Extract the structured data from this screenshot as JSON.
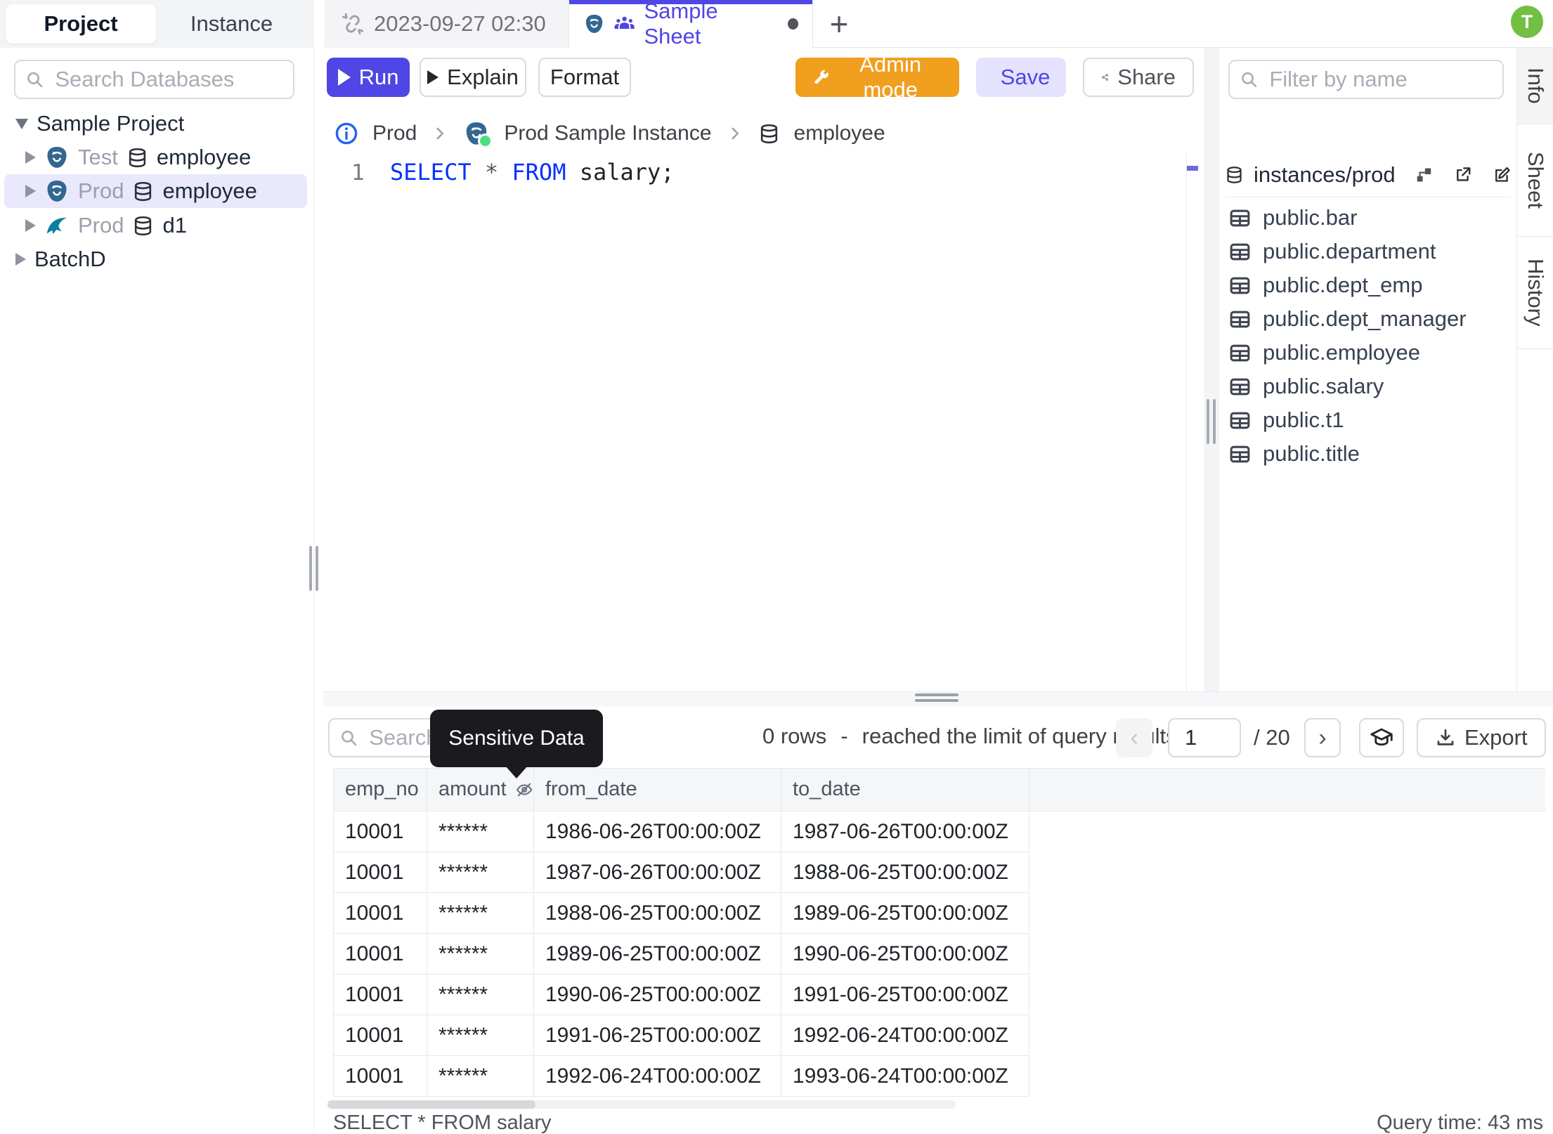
{
  "colors": {
    "accent": "#4f46e5",
    "accent-soft": "#e4e2fc",
    "admin-orange": "#f09f1f",
    "avatar-green": "#72bf44",
    "keyword-blue": "#0433ff",
    "tooltip-bg": "#1b1b1f",
    "postgres-blue": "#336791",
    "mysql-teal": "#0d7ea0",
    "status-green": "#4ade80",
    "info-blue": "#2563eb"
  },
  "sidebar": {
    "tabs": {
      "project": "Project",
      "instance": "Instance"
    },
    "search_placeholder": "Search Databases",
    "tree": [
      {
        "label": "Sample Project"
      },
      {
        "env": "Test",
        "db": "employee"
      },
      {
        "env": "Prod",
        "db": "employee"
      },
      {
        "env": "Prod",
        "db": "d1"
      },
      {
        "label": "BatchD"
      }
    ]
  },
  "tabbar": {
    "tab1": "2023-09-27 02:30",
    "tab2": "Sample Sheet",
    "new_tab": "+"
  },
  "toolbar": {
    "run": "Run",
    "explain": "Explain",
    "format": "Format",
    "admin_mode": "Admin mode",
    "save": "Save",
    "share": "Share"
  },
  "breadcrumb": {
    "environment": "Prod",
    "instance": "Prod Sample Instance",
    "database": "employee"
  },
  "editor": {
    "line_number": "1",
    "kw_select": "SELECT",
    "star": "*",
    "kw_from": "FROM",
    "identifier": "salary;"
  },
  "right_panel": {
    "filter_placeholder": "Filter by name",
    "header": "instances/prod",
    "tables": [
      "public.bar",
      "public.department",
      "public.dept_emp",
      "public.dept_manager",
      "public.employee",
      "public.salary",
      "public.t1",
      "public.title"
    ]
  },
  "side_tabs": {
    "info": "Info",
    "sheet": "Sheet",
    "history": "History"
  },
  "user": {
    "avatar_initial": "T"
  },
  "results": {
    "search_placeholder": "Search",
    "tooltip": "Sensitive Data",
    "rows_count": "0 rows",
    "separator": "-",
    "limit_message": "reached the limit of query results",
    "page": "1",
    "page_total": "/ 20",
    "export_label": "Export",
    "columns": [
      "emp_no",
      "amount",
      "from_date",
      "to_date"
    ],
    "rows": [
      [
        "10001",
        "******",
        "1986-06-26T00:00:00Z",
        "1987-06-26T00:00:00Z"
      ],
      [
        "10001",
        "******",
        "1987-06-26T00:00:00Z",
        "1988-06-25T00:00:00Z"
      ],
      [
        "10001",
        "******",
        "1988-06-25T00:00:00Z",
        "1989-06-25T00:00:00Z"
      ],
      [
        "10001",
        "******",
        "1989-06-25T00:00:00Z",
        "1990-06-25T00:00:00Z"
      ],
      [
        "10001",
        "******",
        "1990-06-25T00:00:00Z",
        "1991-06-25T00:00:00Z"
      ],
      [
        "10001",
        "******",
        "1991-06-25T00:00:00Z",
        "1992-06-24T00:00:00Z"
      ],
      [
        "10001",
        "******",
        "1992-06-24T00:00:00Z",
        "1993-06-24T00:00:00Z"
      ]
    ],
    "status_left": "SELECT * FROM salary",
    "status_right": "Query time: 43 ms"
  }
}
